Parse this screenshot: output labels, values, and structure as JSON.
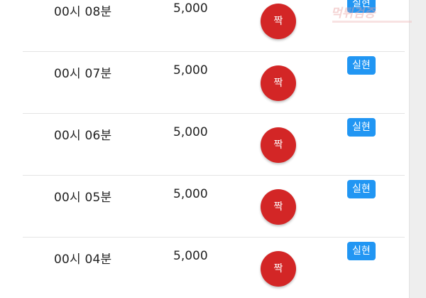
{
  "results": {
    "rows": [
      {
        "time": "00시 08분",
        "amount": "5,000",
        "bet": "짝",
        "status": "실현"
      },
      {
        "time": "00시 07분",
        "amount": "5,000",
        "bet": "짝",
        "status": "실현"
      },
      {
        "time": "00시 06분",
        "amount": "5,000",
        "bet": "짝",
        "status": "실현"
      },
      {
        "time": "00시 05분",
        "amount": "5,000",
        "bet": "짝",
        "status": "실현"
      },
      {
        "time": "00시 04분",
        "amount": "5,000",
        "bet": "짝",
        "status": "실현"
      }
    ]
  },
  "watermark": {
    "text": "먹튀검증"
  },
  "colors": {
    "bet_circle": "#d32626",
    "status_badge": "#2196f3"
  }
}
